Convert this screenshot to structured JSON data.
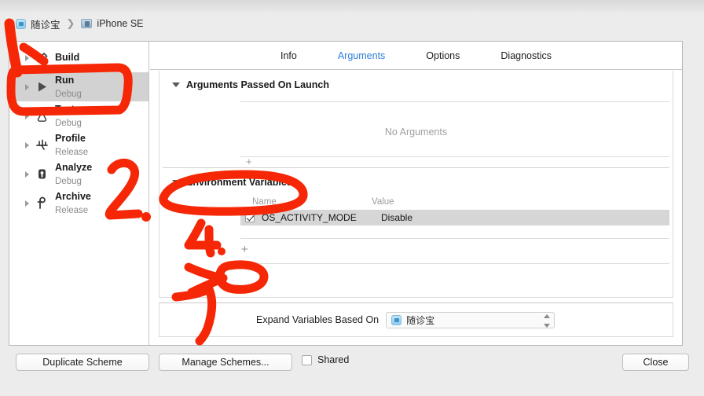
{
  "breadcrumb": {
    "project": "随诊宝",
    "separator": "❯",
    "device": "iPhone SE",
    "project_icon": "app-icon",
    "device_icon": "device-icon"
  },
  "sidebar": {
    "items": [
      {
        "name": "Build",
        "sub": "",
        "icon": "build-hammer-icon",
        "selected": false
      },
      {
        "name": "Run",
        "sub": "Debug",
        "icon": "run-play-icon",
        "selected": true
      },
      {
        "name": "Test",
        "sub": "Debug",
        "icon": "test-flask-icon",
        "selected": false
      },
      {
        "name": "Profile",
        "sub": "Release",
        "icon": "profile-gauge-icon",
        "selected": false
      },
      {
        "name": "Analyze",
        "sub": "Debug",
        "icon": "analyze-scope-icon",
        "selected": false
      },
      {
        "name": "Archive",
        "sub": "Release",
        "icon": "archive-icon",
        "selected": false
      }
    ]
  },
  "tabs": [
    {
      "label": "Info",
      "active": false
    },
    {
      "label": "Arguments",
      "active": true
    },
    {
      "label": "Options",
      "active": false
    },
    {
      "label": "Diagnostics",
      "active": false
    }
  ],
  "arguments_section": {
    "title": "Arguments Passed On Launch",
    "empty_text": "No Arguments",
    "add_label": "+"
  },
  "environment_section": {
    "title": "Environment Variables",
    "columns": {
      "name": "Name",
      "value": "Value"
    },
    "rows": [
      {
        "enabled": true,
        "name": "OS_ACTIVITY_MODE",
        "value": "Disable",
        "selected": true
      }
    ],
    "add_label": "+"
  },
  "expand_bar": {
    "label": "Expand Variables Based On",
    "selected": "随诊宝",
    "icon": "app-icon"
  },
  "footer": {
    "duplicate_scheme": "Duplicate Scheme",
    "manage_schemes": "Manage Schemes...",
    "shared_label": "Shared",
    "shared_checked": false,
    "close": "Close"
  },
  "annotations": {
    "color": "#f52706",
    "marks": [
      {
        "name": "stroke-one",
        "kind": "digit-1"
      },
      {
        "name": "arrow-to-build",
        "kind": "arrow"
      },
      {
        "name": "highlight-run",
        "kind": "rounded-rect"
      },
      {
        "name": "digit-two",
        "kind": "digit-2"
      },
      {
        "name": "highlight-environment-variables",
        "kind": "ellipse"
      },
      {
        "name": "digit-four",
        "kind": "digit-4"
      },
      {
        "name": "highlight-add-button",
        "kind": "ellipse"
      },
      {
        "name": "digit-three",
        "kind": "digit-3"
      }
    ]
  },
  "colors": {
    "accent_blue": "#2f7fd8",
    "annotation_red": "#f52706",
    "window_chrome": "#ececec",
    "selected_row": "#d2d2d2"
  }
}
